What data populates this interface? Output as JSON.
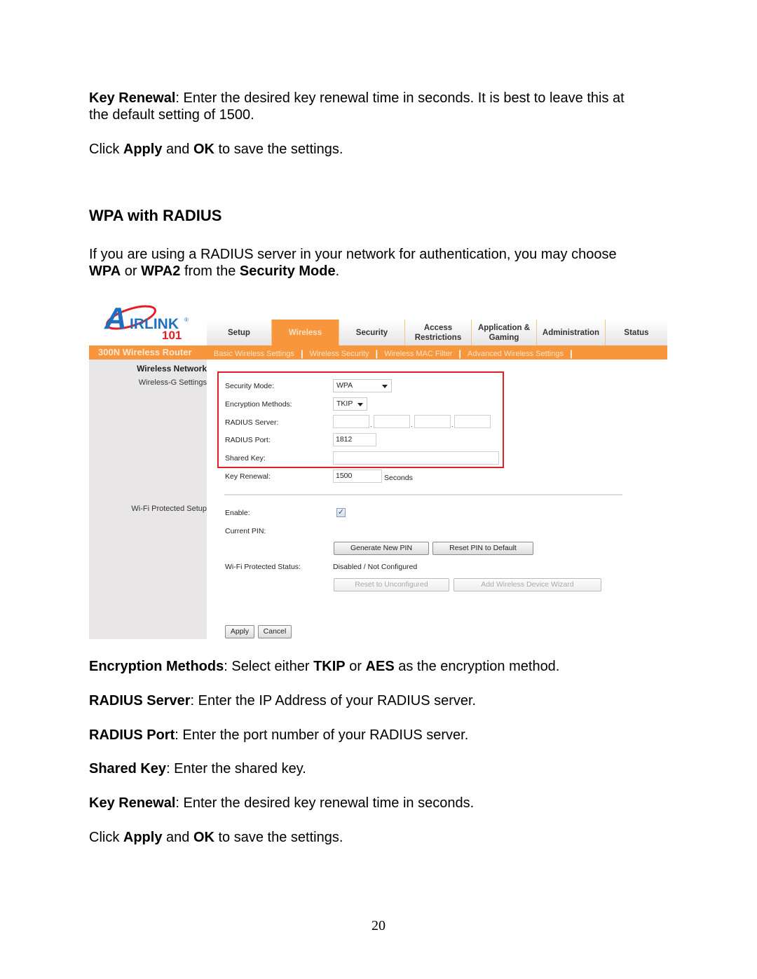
{
  "doc": {
    "intro_para_1": {
      "term": "Key Renewal",
      "line1_text": ": Enter the desired key renewal time in seconds.  It is best to leave this at",
      "line2_text": "the default setting of 1500."
    },
    "intro_para_2": {
      "pre": "Click ",
      "b1": "Apply",
      "mid": " and ",
      "b2": "OK",
      "post": " to save the settings."
    },
    "heading": "WPA with RADIUS",
    "desc": {
      "line1": "If you are using a RADIUS server in your network for authentication, you may choose",
      "b1": "WPA",
      "t1": " or ",
      "b2": "WPA2",
      "t2": " from the ",
      "b3": "Security Mode",
      "t3": "."
    },
    "definitions": [
      {
        "term": "Encryption Methods",
        "text_a": ": Select either ",
        "b1": "TKIP",
        "text_b": " or ",
        "b2": "AES",
        "text_c": " as the encryption method."
      },
      {
        "term": "RADIUS Server",
        "text": ": Enter the IP Address of your RADIUS server."
      },
      {
        "term": "RADIUS Port",
        "text": ": Enter the port number of your RADIUS server."
      },
      {
        "term": "Shared Key",
        "text": ": Enter the shared key."
      },
      {
        "term": "Key Renewal",
        "text": ": Enter the desired key renewal time in seconds."
      }
    ],
    "outro": {
      "pre": "Click ",
      "b1": "Apply",
      "mid": " and ",
      "b2": "OK",
      "post": " to save the settings."
    },
    "page_number": "20"
  },
  "router": {
    "logo": {
      "text_a": "A",
      "text_main": "IRLINK",
      "text_num": "101",
      "reg": "®"
    },
    "brand": "300N Wireless Router",
    "tabs": [
      {
        "label": "Setup",
        "active": false
      },
      {
        "label": "Wireless",
        "active": true
      },
      {
        "label": "Security",
        "active": false
      },
      {
        "label": "Access Restrictions",
        "active": false
      },
      {
        "label": "Application & Gaming",
        "active": false
      },
      {
        "label": "Administration",
        "active": false
      },
      {
        "label": "Status",
        "active": false
      }
    ],
    "subnav": [
      "Basic Wireless Settings",
      "Wireless Security",
      "Wireless MAC Filter",
      "Advanced Wireless Settings"
    ],
    "sidebar": {
      "section1": "Wireless Network",
      "section1_sub": "Wireless-G Settings",
      "section2": "Wi-Fi Protected Setup"
    },
    "form": {
      "security_mode_label": "Security Mode:",
      "security_mode_value": "WPA",
      "encryption_label": "Encryption Methods:",
      "encryption_value": "TKIP",
      "radius_server_label": "RADIUS Server:",
      "radius_server_octets": [
        "",
        "",
        "",
        ""
      ],
      "radius_port_label": "RADIUS Port:",
      "radius_port_value": "1812",
      "shared_key_label": "Shared Key:",
      "shared_key_value": "",
      "key_renewal_label": "Key Renewal:",
      "key_renewal_value": "1500",
      "key_renewal_unit": "Seconds"
    },
    "wps": {
      "enable_label": "Enable:",
      "enable_checked": true,
      "current_pin_label": "Current PIN:",
      "generate_pin_button": "Generate New PIN",
      "reset_pin_button": "Reset PIN to Default",
      "status_label": "Wi-Fi Protected Status:",
      "status_value": "Disabled / Not Configured",
      "reset_unconfigured_button": "Reset to Unconfigured",
      "add_device_button": "Add Wireless Device Wizard"
    },
    "actions": {
      "apply": "Apply",
      "cancel": "Cancel"
    },
    "colors": {
      "accent_orange": "#f7963c",
      "highlight_red": "#e31e24",
      "sidebar_gray": "#e8e6e7"
    }
  }
}
